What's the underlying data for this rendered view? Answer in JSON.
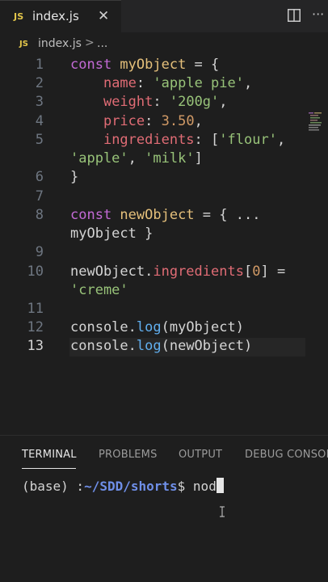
{
  "tab": {
    "badge": "JS",
    "title": "index.js",
    "close_glyph": "✕"
  },
  "window_actions": {
    "split": "split-editor-icon",
    "more": "···"
  },
  "breadcrumb": {
    "badge": "JS",
    "file": "index.js",
    "separator": ">",
    "more": "..."
  },
  "editor": {
    "line_numbers": [
      "1",
      "2",
      "3",
      "4",
      "5",
      "6",
      "7",
      "8",
      "9",
      "10",
      "11",
      "12",
      "13"
    ],
    "active_line": "13",
    "code": {
      "l1": {
        "kw": "const",
        "name": " myObject",
        "rest": " = {"
      },
      "l2": {
        "indent": "    ",
        "prop": "name",
        "colon": ": ",
        "val": "'apple pie'",
        "end": ","
      },
      "l3": {
        "indent": "    ",
        "prop": "weight",
        "colon": ": ",
        "val": "'200g'",
        "end": ","
      },
      "l4": {
        "indent": "    ",
        "prop": "price",
        "colon": ": ",
        "val": "3.50",
        "end": ","
      },
      "l5": {
        "indent": "    ",
        "prop": "ingredients",
        "colon": ": ",
        "open": "[",
        "val": "'flour'",
        "end": ","
      },
      "l5b": {
        "indent": "    ",
        "v1": "'apple'",
        "sep": ", ",
        "v2": "'milk'",
        "close": "]"
      },
      "l6": {
        "text": "}"
      },
      "l8": {
        "kw": "const",
        "name": " newObject",
        "rest": " = { ..."
      },
      "l8b": {
        "text": "myObject }"
      },
      "l10": {
        "obj": "newObject.",
        "prop": "ingredients",
        "open": "[",
        "idx": "0",
        "close": "]",
        "rest": " ="
      },
      "l10b": {
        "val": "'creme'"
      },
      "l12": {
        "obj": "console.",
        "fn": "log",
        "args": "(myObject)"
      },
      "l13": {
        "obj": "console.",
        "fn": "log",
        "args": "(newObject)"
      }
    }
  },
  "panel": {
    "tabs": [
      "TERMINAL",
      "PROBLEMS",
      "OUTPUT",
      "DEBUG CONSOLE"
    ],
    "active_tab": "TERMINAL",
    "terminal": {
      "env": "(base)",
      "sep": " :",
      "path": "~/SDD/shorts",
      "prompt": "$ ",
      "input": "nod"
    }
  },
  "colors": {
    "keyword": "#c36ad6",
    "variable": "#e5c07b",
    "property": "#e06c75",
    "string": "#98c379",
    "number": "#d19a66",
    "function": "#61afef",
    "terminal_path": "#6f8fe8",
    "js_badge": "#e3c64a"
  }
}
